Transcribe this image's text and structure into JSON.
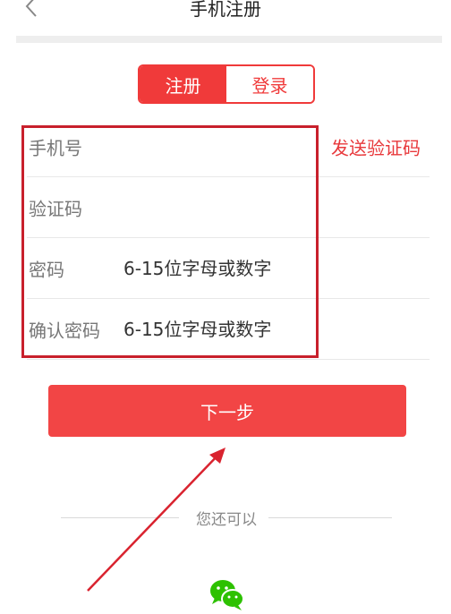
{
  "header": {
    "title": "手机注册",
    "back_icon": "chevron-left-icon"
  },
  "tabs": [
    {
      "label": "注册",
      "active": true
    },
    {
      "label": "登录",
      "active": false
    }
  ],
  "form": {
    "phone": {
      "label": "手机号",
      "value": "",
      "placeholder": ""
    },
    "send_code_label": "发送验证码",
    "code": {
      "label": "验证码",
      "value": "",
      "placeholder": ""
    },
    "password": {
      "label": "密码",
      "placeholder": "6-15位字母或数字"
    },
    "confirm": {
      "label": "确认密码",
      "placeholder": "6-15位字母或数字"
    }
  },
  "next_label": "下一步",
  "alt_login": {
    "text": "您还可以",
    "icon": "wechat-icon"
  },
  "colors": {
    "accent": "#f03a3a",
    "button": "#f24545",
    "highlight": "#c8202c",
    "divider": "#e8e8e8"
  }
}
